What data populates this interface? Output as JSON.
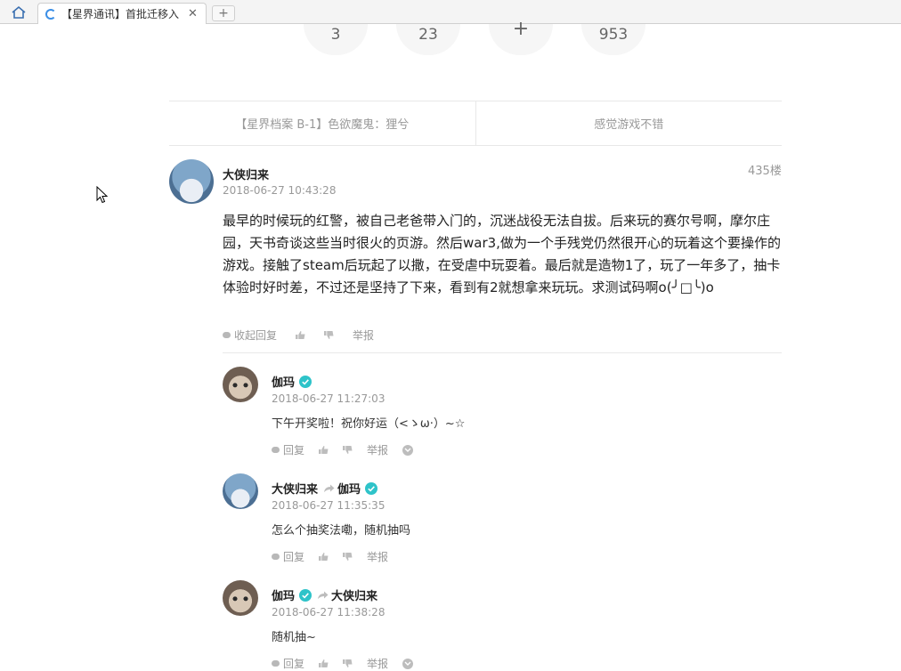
{
  "browser": {
    "tab_title": "【星界通讯】首批迁移入",
    "tab_close": "✕",
    "new_tab": "+"
  },
  "stats": [
    "3",
    "23",
    "+",
    "953"
  ],
  "nav": {
    "prev": "【星界档案 B-1】色欲魔鬼：狸兮",
    "next": "感觉游戏不错"
  },
  "comment": {
    "user": "大侠归来",
    "time": "2018-06-27 10:43:28",
    "floor": "435楼",
    "text": "最早的时候玩的红警，被自己老爸带入门的，沉迷战役无法自拔。后来玩的赛尔号啊，摩尔庄园，天书奇谈这些当时很火的页游。然后war3,做为一个手残党仍然很开心的玩着这个要操作的游戏。接触了steam后玩起了以撒，在受虐中玩耍着。最后就是造物1了，玩了一年多了，抽卡体验时好时差，不过还是坚持了下来，看到有2就想拿来玩玩。求测试码啊o(╯□╰)o",
    "collapse_label": "收起回复",
    "report_label": "举报"
  },
  "replies": [
    {
      "user": "伽玛",
      "verified": true,
      "reply_to": "",
      "time": "2018-06-27 11:27:03",
      "text": "下午开奖啦！祝你好运（<ゝω·）~☆",
      "reply_label": "回复",
      "report_label": "举报"
    },
    {
      "user": "大侠归来",
      "verified": false,
      "reply_to": "伽玛",
      "time": "2018-06-27 11:35:35",
      "text": "怎么个抽奖法嘞，随机抽吗",
      "reply_label": "回复",
      "report_label": "举报"
    },
    {
      "user": "伽玛",
      "verified": true,
      "reply_to": "大侠归来",
      "time": "2018-06-27 11:38:28",
      "text": "随机抽~",
      "reply_label": "回复",
      "report_label": "举报"
    }
  ],
  "colors": {
    "verified": "#2ec3c9",
    "accent": "#3a8ee6"
  }
}
